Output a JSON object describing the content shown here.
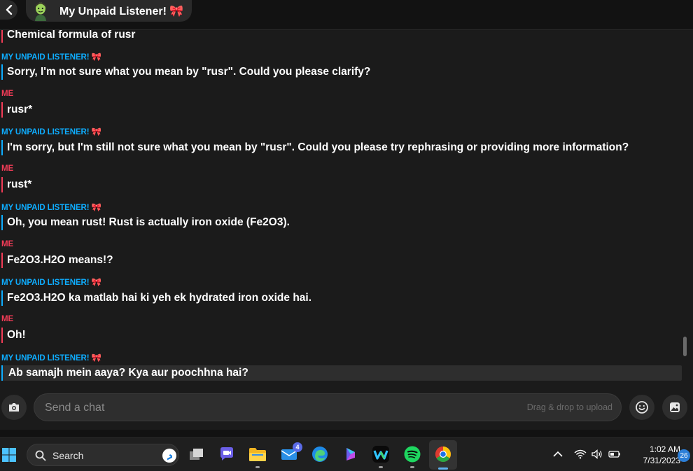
{
  "header": {
    "back_icon": "chevron-left-icon",
    "avatar_icon": "bitmoji-avatar-icon",
    "title": "My Unpaid Listener! 🎀"
  },
  "colors": {
    "me": "#f23c57",
    "bot": "#0eadff",
    "background": "#1b1b1b"
  },
  "messages": [
    {
      "sender": "",
      "role": "me",
      "text": "Chemical formula of rusr"
    },
    {
      "sender": "MY UNPAID LISTENER! 🎀",
      "role": "bot",
      "text": "Sorry, I'm not sure what you mean by \"rusr\". Could you please clarify?"
    },
    {
      "sender": "ME",
      "role": "me",
      "text": "rusr*"
    },
    {
      "sender": "MY UNPAID LISTENER! 🎀",
      "role": "bot",
      "text": "I'm sorry, but I'm still not sure what you mean by \"rusr\". Could you please try rephrasing or providing more information?"
    },
    {
      "sender": "ME",
      "role": "me",
      "text": "rust*"
    },
    {
      "sender": "MY UNPAID LISTENER! 🎀",
      "role": "bot",
      "text": "Oh, you mean rust! Rust is actually iron oxide (Fe2O3)."
    },
    {
      "sender": "ME",
      "role": "me",
      "text": "Fe2O3.H2O means!?"
    },
    {
      "sender": "MY UNPAID LISTENER! 🎀",
      "role": "bot",
      "text": "Fe2O3.H2O ka matlab hai ki yeh ek hydrated iron oxide hai."
    },
    {
      "sender": "ME",
      "role": "me",
      "text": "Oh!"
    },
    {
      "sender": "MY UNPAID LISTENER! 🎀",
      "role": "bot",
      "text": "Ab samajh mein aaya? Kya aur poochhna hai?"
    }
  ],
  "composer": {
    "placeholder": "Send a chat",
    "drag_hint": "Drag & drop to upload",
    "camera_icon": "camera-icon",
    "emoji_icon": "emoji-icon",
    "sticker_icon": "sticker-icon"
  },
  "taskbar": {
    "search_label": "Search",
    "mail_badge": "4",
    "time": "1:02 AM",
    "date": "7/31/2023",
    "notification_count": "26"
  }
}
